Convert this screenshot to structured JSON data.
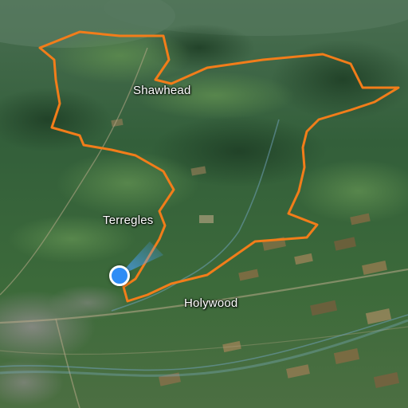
{
  "map": {
    "view": "satellite-3d",
    "route_color": "#f27d1a",
    "labels": {
      "shawhead": "Shawhead",
      "terregles": "Terregles",
      "holywood": "Holywood"
    },
    "user_location": {
      "icon": "location-dot-icon",
      "color": "#2f8df5",
      "heading_cone": true
    }
  }
}
